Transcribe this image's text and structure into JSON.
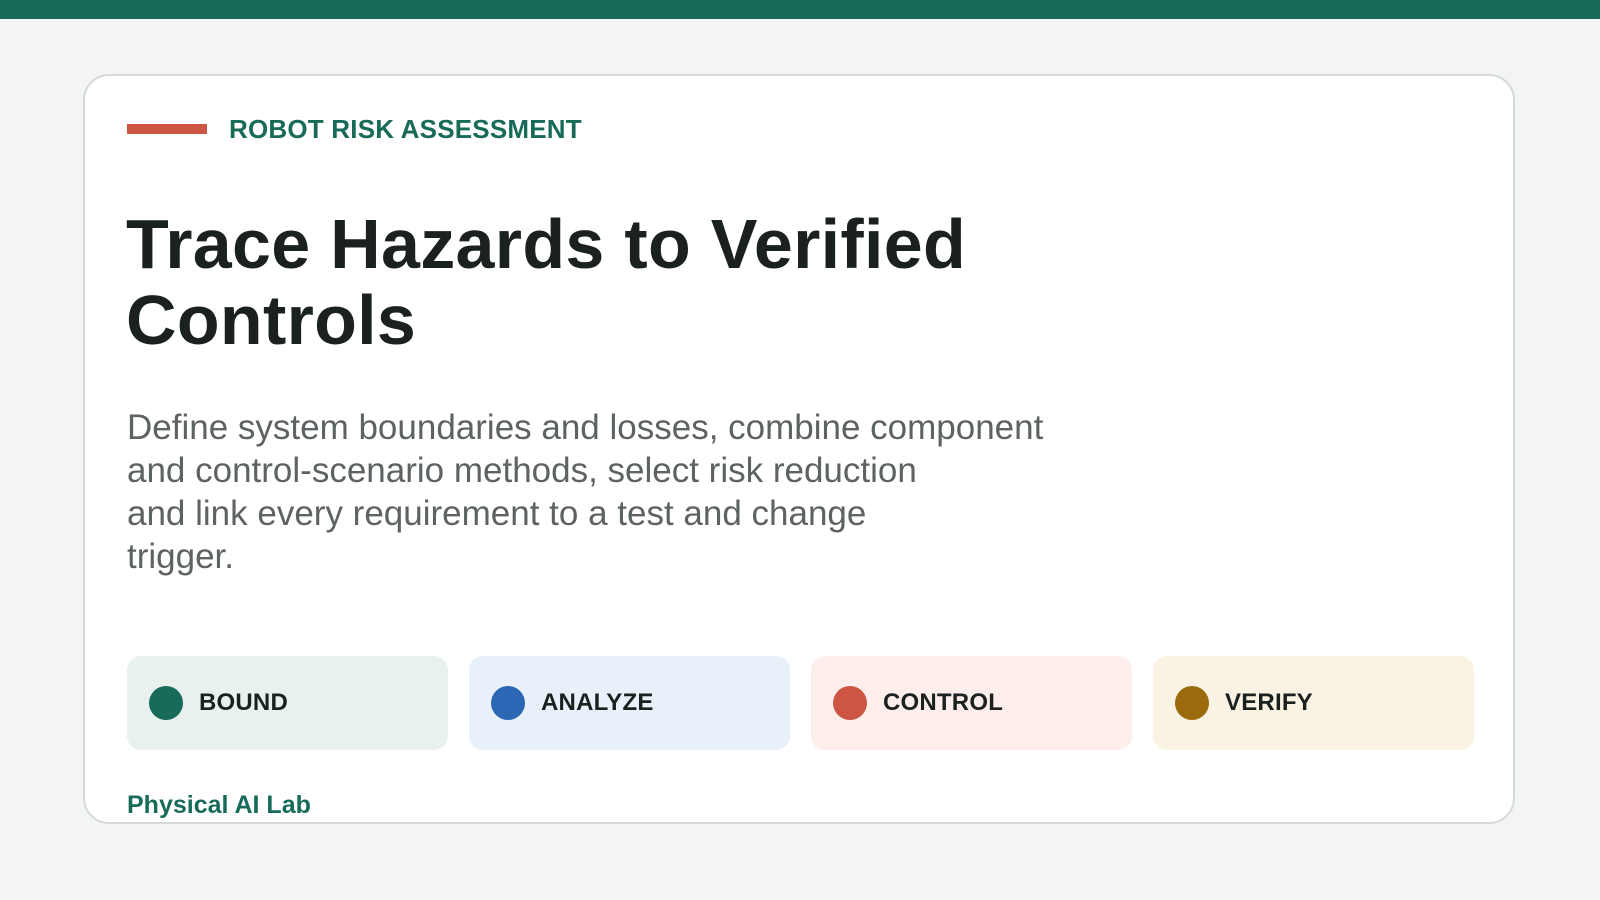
{
  "header": {
    "kicker": "ROBOT RISK ASSESSMENT",
    "accent_color": "#cc5544",
    "brand_color": "#186b59"
  },
  "main": {
    "title_lines": [
      "Trace Hazards to Verified",
      "Controls"
    ],
    "description_lines": [
      "Define system boundaries and losses, combine component",
      "and control-scenario methods, select risk reduction",
      "and link every requirement to a test and change",
      "trigger."
    ]
  },
  "steps": [
    {
      "label": "BOUND",
      "dot_color": "#186b59",
      "bg_color": "#e8f1ee"
    },
    {
      "label": "ANALYZE",
      "dot_color": "#2a67b5",
      "bg_color": "#e8f0fa"
    },
    {
      "label": "CONTROL",
      "dot_color": "#cc5544",
      "bg_color": "#fdeeec"
    },
    {
      "label": "VERIFY",
      "dot_color": "#9a6a0c",
      "bg_color": "#faf2e2"
    }
  ],
  "footer": {
    "org": "Physical AI Lab"
  }
}
